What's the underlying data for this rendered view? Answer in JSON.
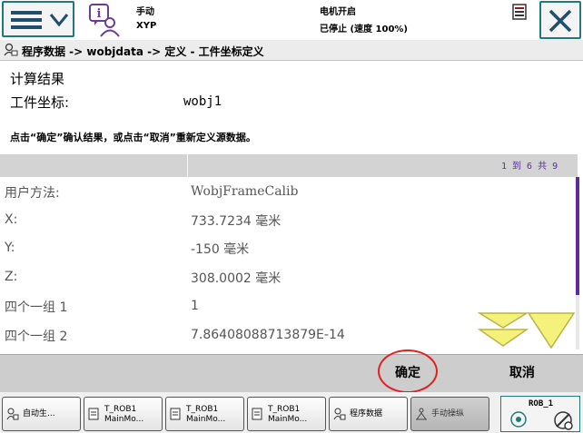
{
  "header": {
    "mode_label": "手动",
    "controller": "XYP",
    "motor_status": "电机开启",
    "run_status": "已停止 (速度 100%)"
  },
  "title": {
    "path": "程序数据 -> wobjdata -> 定义 - 工件坐标定义"
  },
  "content": {
    "heading": "计算结果",
    "wobj_label": "工件坐标:",
    "wobj_value": "wobj1",
    "hint": "点击“确定”确认结果，或点击“取消”重新定义源数据。"
  },
  "table": {
    "row_count": "1 到 6 共 9",
    "rows": [
      {
        "label": "用户方法:",
        "value": "WobjFrameCalib"
      },
      {
        "label": "X:",
        "value": "733.7234 毫米"
      },
      {
        "label": "Y:",
        "value": "-150 毫米"
      },
      {
        "label": "Z:",
        "value": "308.0002 毫米"
      },
      {
        "label": "四个一组 1",
        "value": "1"
      },
      {
        "label": "四个一组 2",
        "value": "7.86408088713879E-14"
      }
    ]
  },
  "actions": {
    "ok_label": "确定",
    "cancel_label": "取消"
  },
  "taskbar": {
    "items": [
      {
        "label": "自动生...",
        "line2": ""
      },
      {
        "label": "T_ROB1",
        "line2": "MainMo..."
      },
      {
        "label": "T_ROB1",
        "line2": "MainMo..."
      },
      {
        "label": "T_ROB1",
        "line2": "MainMo..."
      },
      {
        "label": "程序数据",
        "line2": ""
      },
      {
        "label": "手动操纵",
        "line2": ""
      }
    ],
    "robot": "ROB_1"
  },
  "colors": {
    "accent": "#1f7a7a",
    "scroll": "#5a2ca0",
    "highlight_circle": "#e02020",
    "arrow_fill": "#f4f27a"
  }
}
